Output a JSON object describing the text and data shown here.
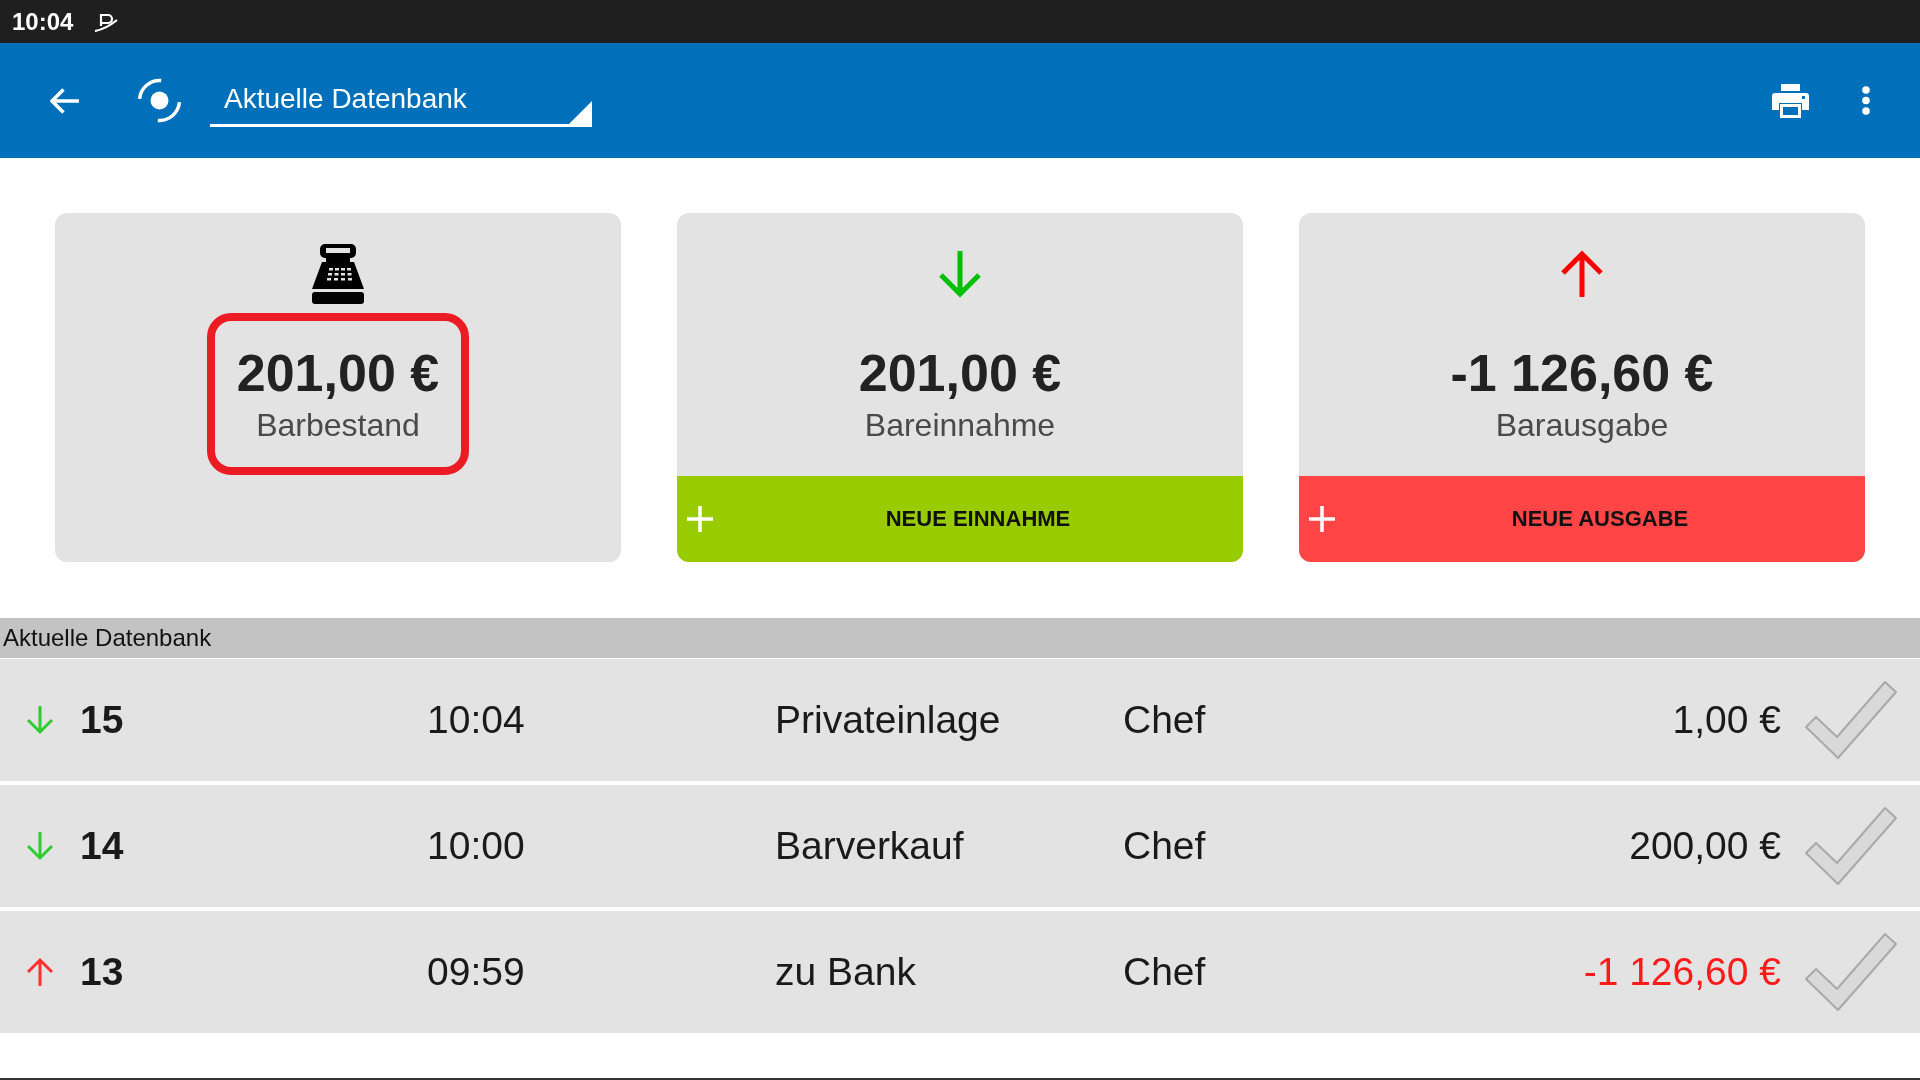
{
  "status_bar": {
    "time": "10:04"
  },
  "app_bar": {
    "database_select": {
      "value": "Aktuelle Datenbank"
    }
  },
  "summary_cards": [
    {
      "kind": "balance",
      "amount": "201,00 €",
      "label": "Barbestand",
      "highlighted": true
    },
    {
      "kind": "income",
      "amount": "201,00 €",
      "label": "Bareinnahme",
      "action": "NEUE EINNAHME",
      "highlighted": false
    },
    {
      "kind": "expense",
      "amount": "-1 126,60 €",
      "label": "Barausgabe",
      "action": "NEUE AUSGABE",
      "highlighted": false
    }
  ],
  "transactions": {
    "header": "Aktuelle Datenbank",
    "rows": [
      {
        "kind": "income",
        "number": "15",
        "time": "10:04",
        "description": "Privateinlage",
        "user": "Chef",
        "amount": "1,00 €"
      },
      {
        "kind": "income",
        "number": "14",
        "time": "10:00",
        "description": "Barverkauf",
        "user": "Chef",
        "amount": "200,00 €"
      },
      {
        "kind": "expense",
        "number": "13",
        "time": "09:59",
        "description": "zu Bank",
        "user": "Chef",
        "amount": "-1 126,60 €"
      }
    ]
  }
}
